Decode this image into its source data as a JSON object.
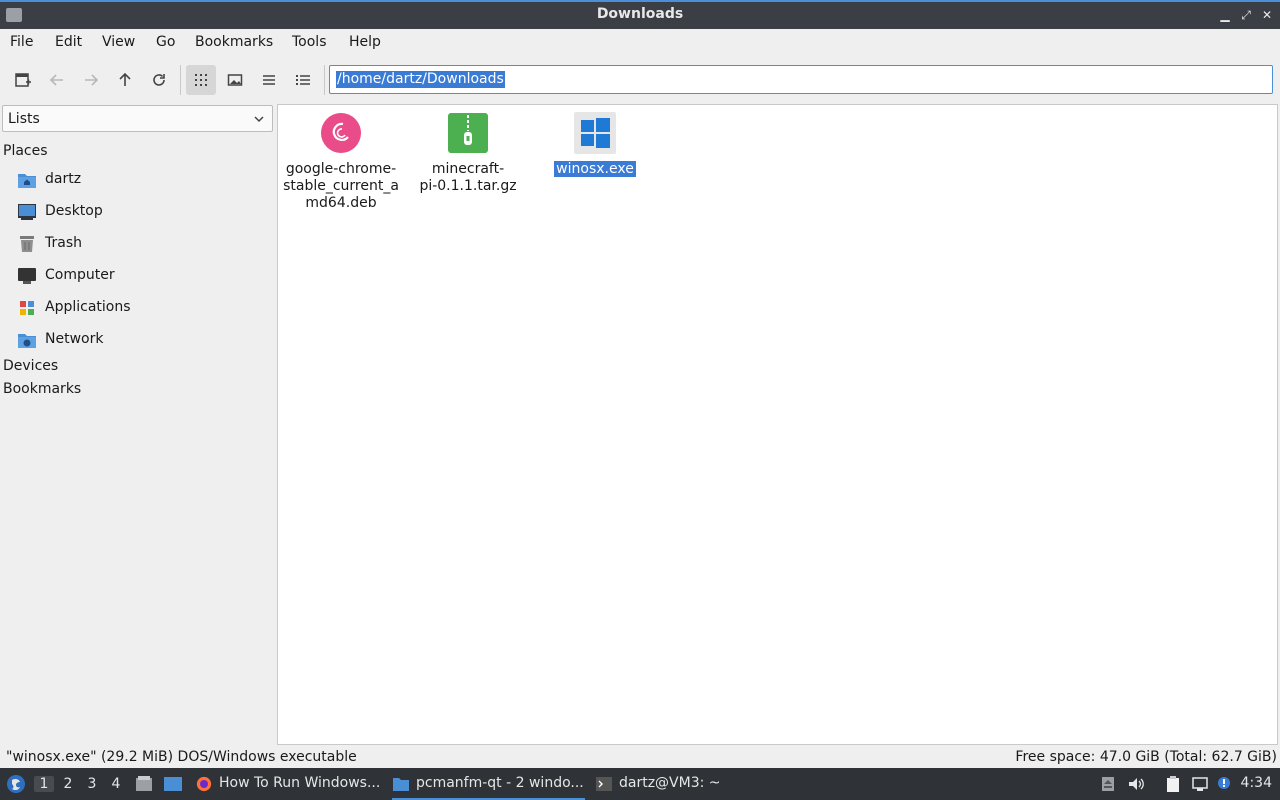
{
  "window": {
    "title": "Downloads",
    "controls": {
      "minimize": "▁",
      "maximize": "⤢",
      "close": "✕"
    }
  },
  "menubar": [
    "File",
    "Edit",
    "View",
    "Go",
    "Bookmarks",
    "Tools",
    "Help"
  ],
  "toolbar": {
    "path": "/home/dartz/Downloads",
    "buttons": [
      "new-tab-icon",
      "back-arrow-icon",
      "forward-arrow-icon",
      "up-arrow-icon",
      "reload-icon",
      "icon-view-icon",
      "thumbnail-view-icon",
      "compact-view-icon",
      "detailed-list-view-icon"
    ]
  },
  "sidebar": {
    "combo_value": "Lists",
    "places_title": "Places",
    "places": [
      {
        "label": "dartz",
        "icon": "home-folder-icon"
      },
      {
        "label": "Desktop",
        "icon": "desktop-icon"
      },
      {
        "label": "Trash",
        "icon": "trash-icon"
      },
      {
        "label": "Computer",
        "icon": "computer-icon"
      },
      {
        "label": "Applications",
        "icon": "applications-icon"
      },
      {
        "label": "Network",
        "icon": "network-folder-icon"
      }
    ],
    "devices_title": "Devices",
    "bookmarks_title": "Bookmarks"
  },
  "files": [
    {
      "name": "google-chrome-stable_current_amd64.deb",
      "display": "google-chrome-\nstable_current_a\nmd64.deb",
      "icon": "debian-package-icon",
      "selected": false
    },
    {
      "name": "minecraft-pi-0.1.1.tar.gz",
      "display": "minecraft-\npi-0.1.1.tar.gz",
      "icon": "archive-icon",
      "selected": false
    },
    {
      "name": "winosx.exe",
      "display": "winosx.exe",
      "icon": "windows-executable-icon",
      "selected": true
    }
  ],
  "statusbar": {
    "selection": "\"winosx.exe\" (29.2 MiB) DOS/Windows executable",
    "free_space": "Free space: 47.0 GiB (Total: 62.7 GiB)"
  },
  "taskbar": {
    "workspaces": [
      "1",
      "2",
      "3",
      "4"
    ],
    "active_workspace": "1",
    "tasks": [
      {
        "label": "How To Run Windows...",
        "icon": "firefox-icon"
      },
      {
        "label": "pcmanfm-qt - 2 windo...",
        "icon": "folder-icon",
        "active": true
      },
      {
        "label": "dartz@VM3: ~",
        "icon": "terminal-icon"
      }
    ],
    "clock": "4:34"
  },
  "colors": {
    "accent": "#3a7bd5",
    "titlebar": "#3b3f45",
    "taskbar": "#2f3338"
  }
}
